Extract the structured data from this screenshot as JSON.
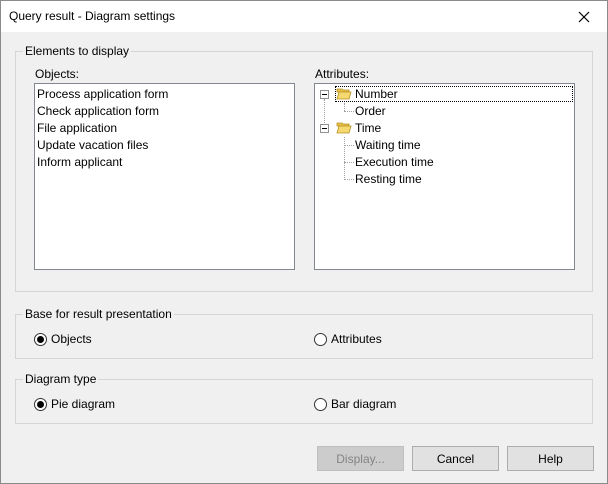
{
  "window": {
    "title": "Query result - Diagram settings"
  },
  "elements_group": {
    "legend": "Elements to display",
    "objects_label": "Objects:",
    "attributes_label": "Attributes:",
    "objects": [
      "Process application form",
      "Check application form",
      "File application",
      "Update vacation files",
      "Inform applicant"
    ],
    "attributes_tree": {
      "number_label": "Number",
      "order_label": "Order",
      "time_label": "Time",
      "waiting_label": "Waiting time",
      "execution_label": "Execution time",
      "resting_label": "Resting time"
    }
  },
  "base_group": {
    "legend": "Base for result presentation",
    "option_objects": "Objects",
    "option_attributes": "Attributes",
    "selected": "Objects"
  },
  "diagram_group": {
    "legend": "Diagram type",
    "option_pie": "Pie diagram",
    "option_bar": "Bar diagram",
    "selected": "Pie diagram"
  },
  "buttons": {
    "display": "Display...",
    "cancel": "Cancel",
    "help": "Help"
  }
}
